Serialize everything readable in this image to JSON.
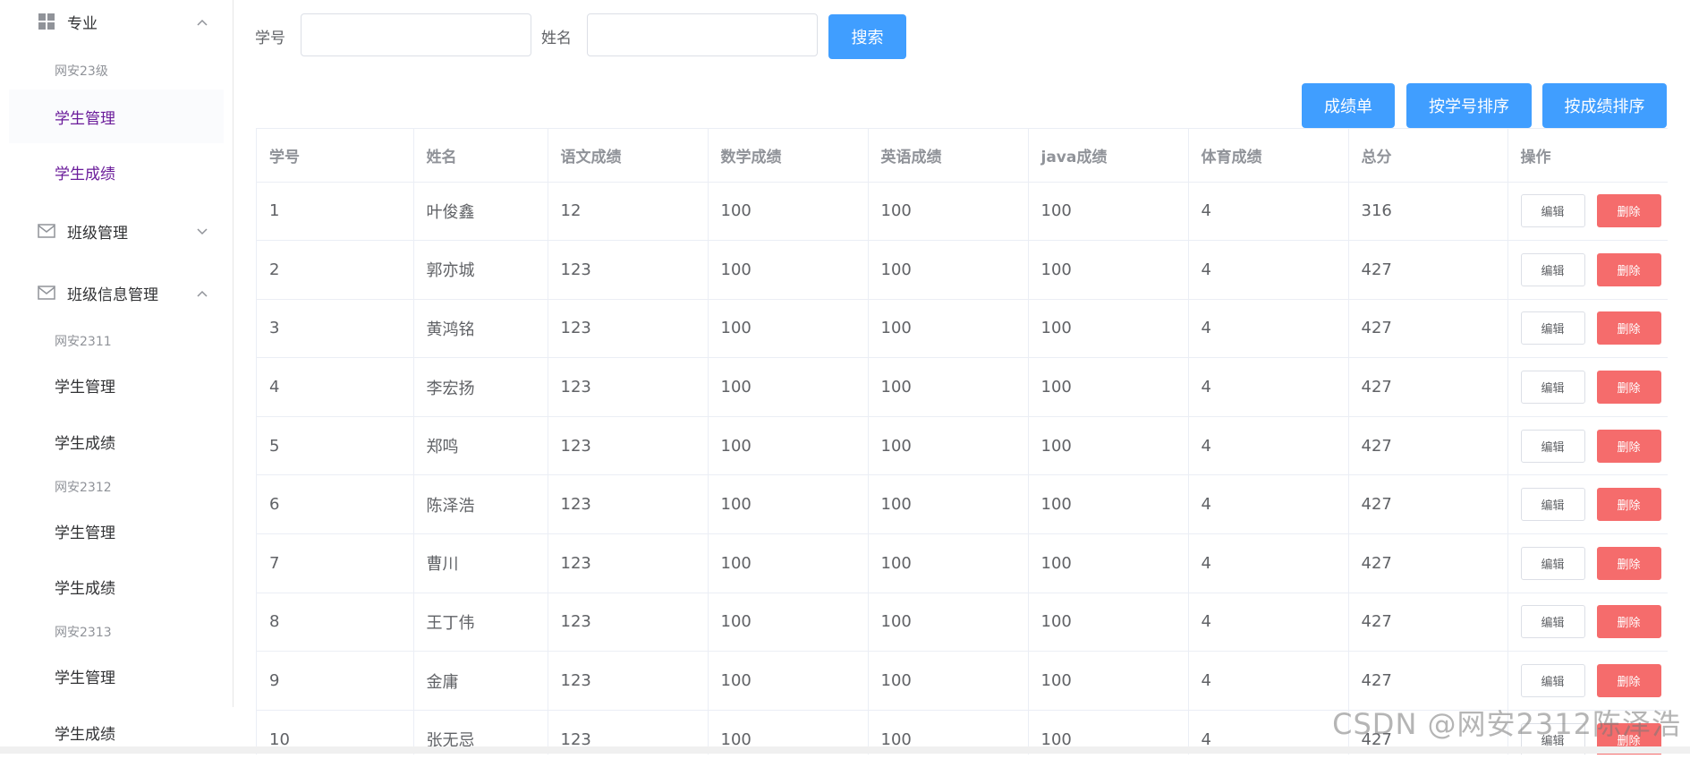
{
  "sidebar": {
    "menu1": {
      "title": "专业",
      "group": "网安23级",
      "items": [
        "学生管理",
        "学生成绩"
      ]
    },
    "menu2": {
      "title": "班级管理"
    },
    "menu3": {
      "title": "班级信息管理",
      "groups": [
        {
          "title": "网安2311",
          "items": [
            "学生管理",
            "学生成绩"
          ]
        },
        {
          "title": "网安2312",
          "items": [
            "学生管理",
            "学生成绩"
          ]
        },
        {
          "title": "网安2313",
          "items": [
            "学生管理",
            "学生成绩"
          ]
        }
      ]
    }
  },
  "search": {
    "id_label": "学号",
    "id_value": "",
    "name_label": "姓名",
    "name_value": "",
    "button": "搜索"
  },
  "toolbar": {
    "report": "成绩单",
    "sort_by_id": "按学号排序",
    "sort_by_score": "按成绩排序"
  },
  "table": {
    "headers": [
      "学号",
      "姓名",
      "语文成绩",
      "数学成绩",
      "英语成绩",
      "java成绩",
      "体育成绩",
      "总分",
      "操作"
    ],
    "edit_label": "编辑",
    "delete_label": "删除",
    "rows": [
      [
        "1",
        "叶俊鑫",
        "12",
        "100",
        "100",
        "100",
        "4",
        "316"
      ],
      [
        "2",
        "郭亦城",
        "123",
        "100",
        "100",
        "100",
        "4",
        "427"
      ],
      [
        "3",
        "黄鸿铭",
        "123",
        "100",
        "100",
        "100",
        "4",
        "427"
      ],
      [
        "4",
        "李宏扬",
        "123",
        "100",
        "100",
        "100",
        "4",
        "427"
      ],
      [
        "5",
        "郑鸣",
        "123",
        "100",
        "100",
        "100",
        "4",
        "427"
      ],
      [
        "6",
        "陈泽浩",
        "123",
        "100",
        "100",
        "100",
        "4",
        "427"
      ],
      [
        "7",
        "曹川",
        "123",
        "100",
        "100",
        "100",
        "4",
        "427"
      ],
      [
        "8",
        "王丁伟",
        "123",
        "100",
        "100",
        "100",
        "4",
        "427"
      ],
      [
        "9",
        "金庸",
        "123",
        "100",
        "100",
        "100",
        "4",
        "427"
      ],
      [
        "10",
        "张无忌",
        "123",
        "100",
        "100",
        "100",
        "4",
        "427"
      ]
    ]
  },
  "watermark": "CSDN @网安2312陈泽浩",
  "colors": {
    "primary": "#409eff",
    "danger": "#f56c6c",
    "purple_text": "#6a1b9a"
  }
}
